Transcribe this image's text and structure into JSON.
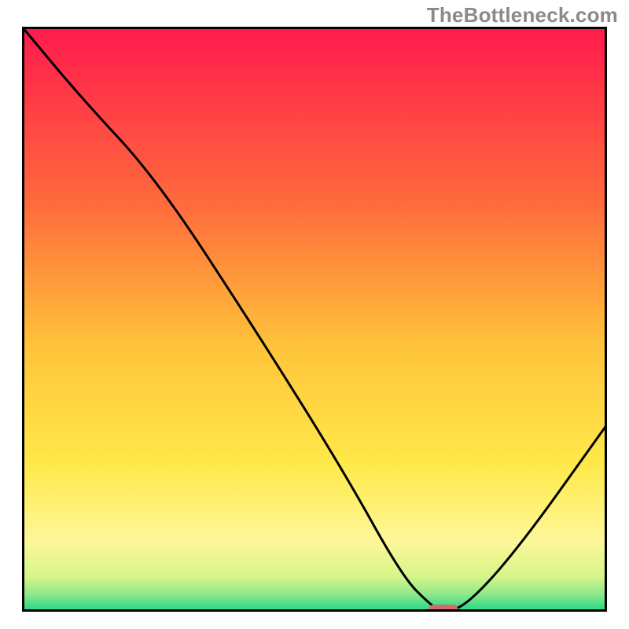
{
  "watermark": "TheBottleneck.com",
  "chart_data": {
    "type": "line",
    "title": "",
    "xlabel": "",
    "ylabel": "",
    "xlim": [
      0,
      100
    ],
    "ylim": [
      0,
      100
    ],
    "grid": false,
    "legend": false,
    "series": [
      {
        "name": "bottleneck-curve",
        "x": [
          0,
          10,
          23,
          40,
          55,
          65,
          70,
          72,
          76,
          85,
          100
        ],
        "y": [
          100,
          88,
          74,
          48,
          24,
          6,
          1,
          0,
          1,
          11,
          32
        ]
      }
    ],
    "marker": {
      "name": "selected-point",
      "x": 72,
      "y": 0,
      "width_pct": 5,
      "color": "#d46a6a"
    },
    "background_gradient": {
      "stops": [
        {
          "offset": 0.0,
          "color": "#ff1a4d"
        },
        {
          "offset": 0.3,
          "color": "#ff6a3c"
        },
        {
          "offset": 0.55,
          "color": "#ffc43a"
        },
        {
          "offset": 0.75,
          "color": "#ffe94a"
        },
        {
          "offset": 0.88,
          "color": "#fdf79a"
        },
        {
          "offset": 0.94,
          "color": "#d6f58a"
        },
        {
          "offset": 0.97,
          "color": "#8ee98a"
        },
        {
          "offset": 1.0,
          "color": "#1fd488"
        }
      ]
    },
    "border_color": "#000000",
    "border_width": 6
  }
}
